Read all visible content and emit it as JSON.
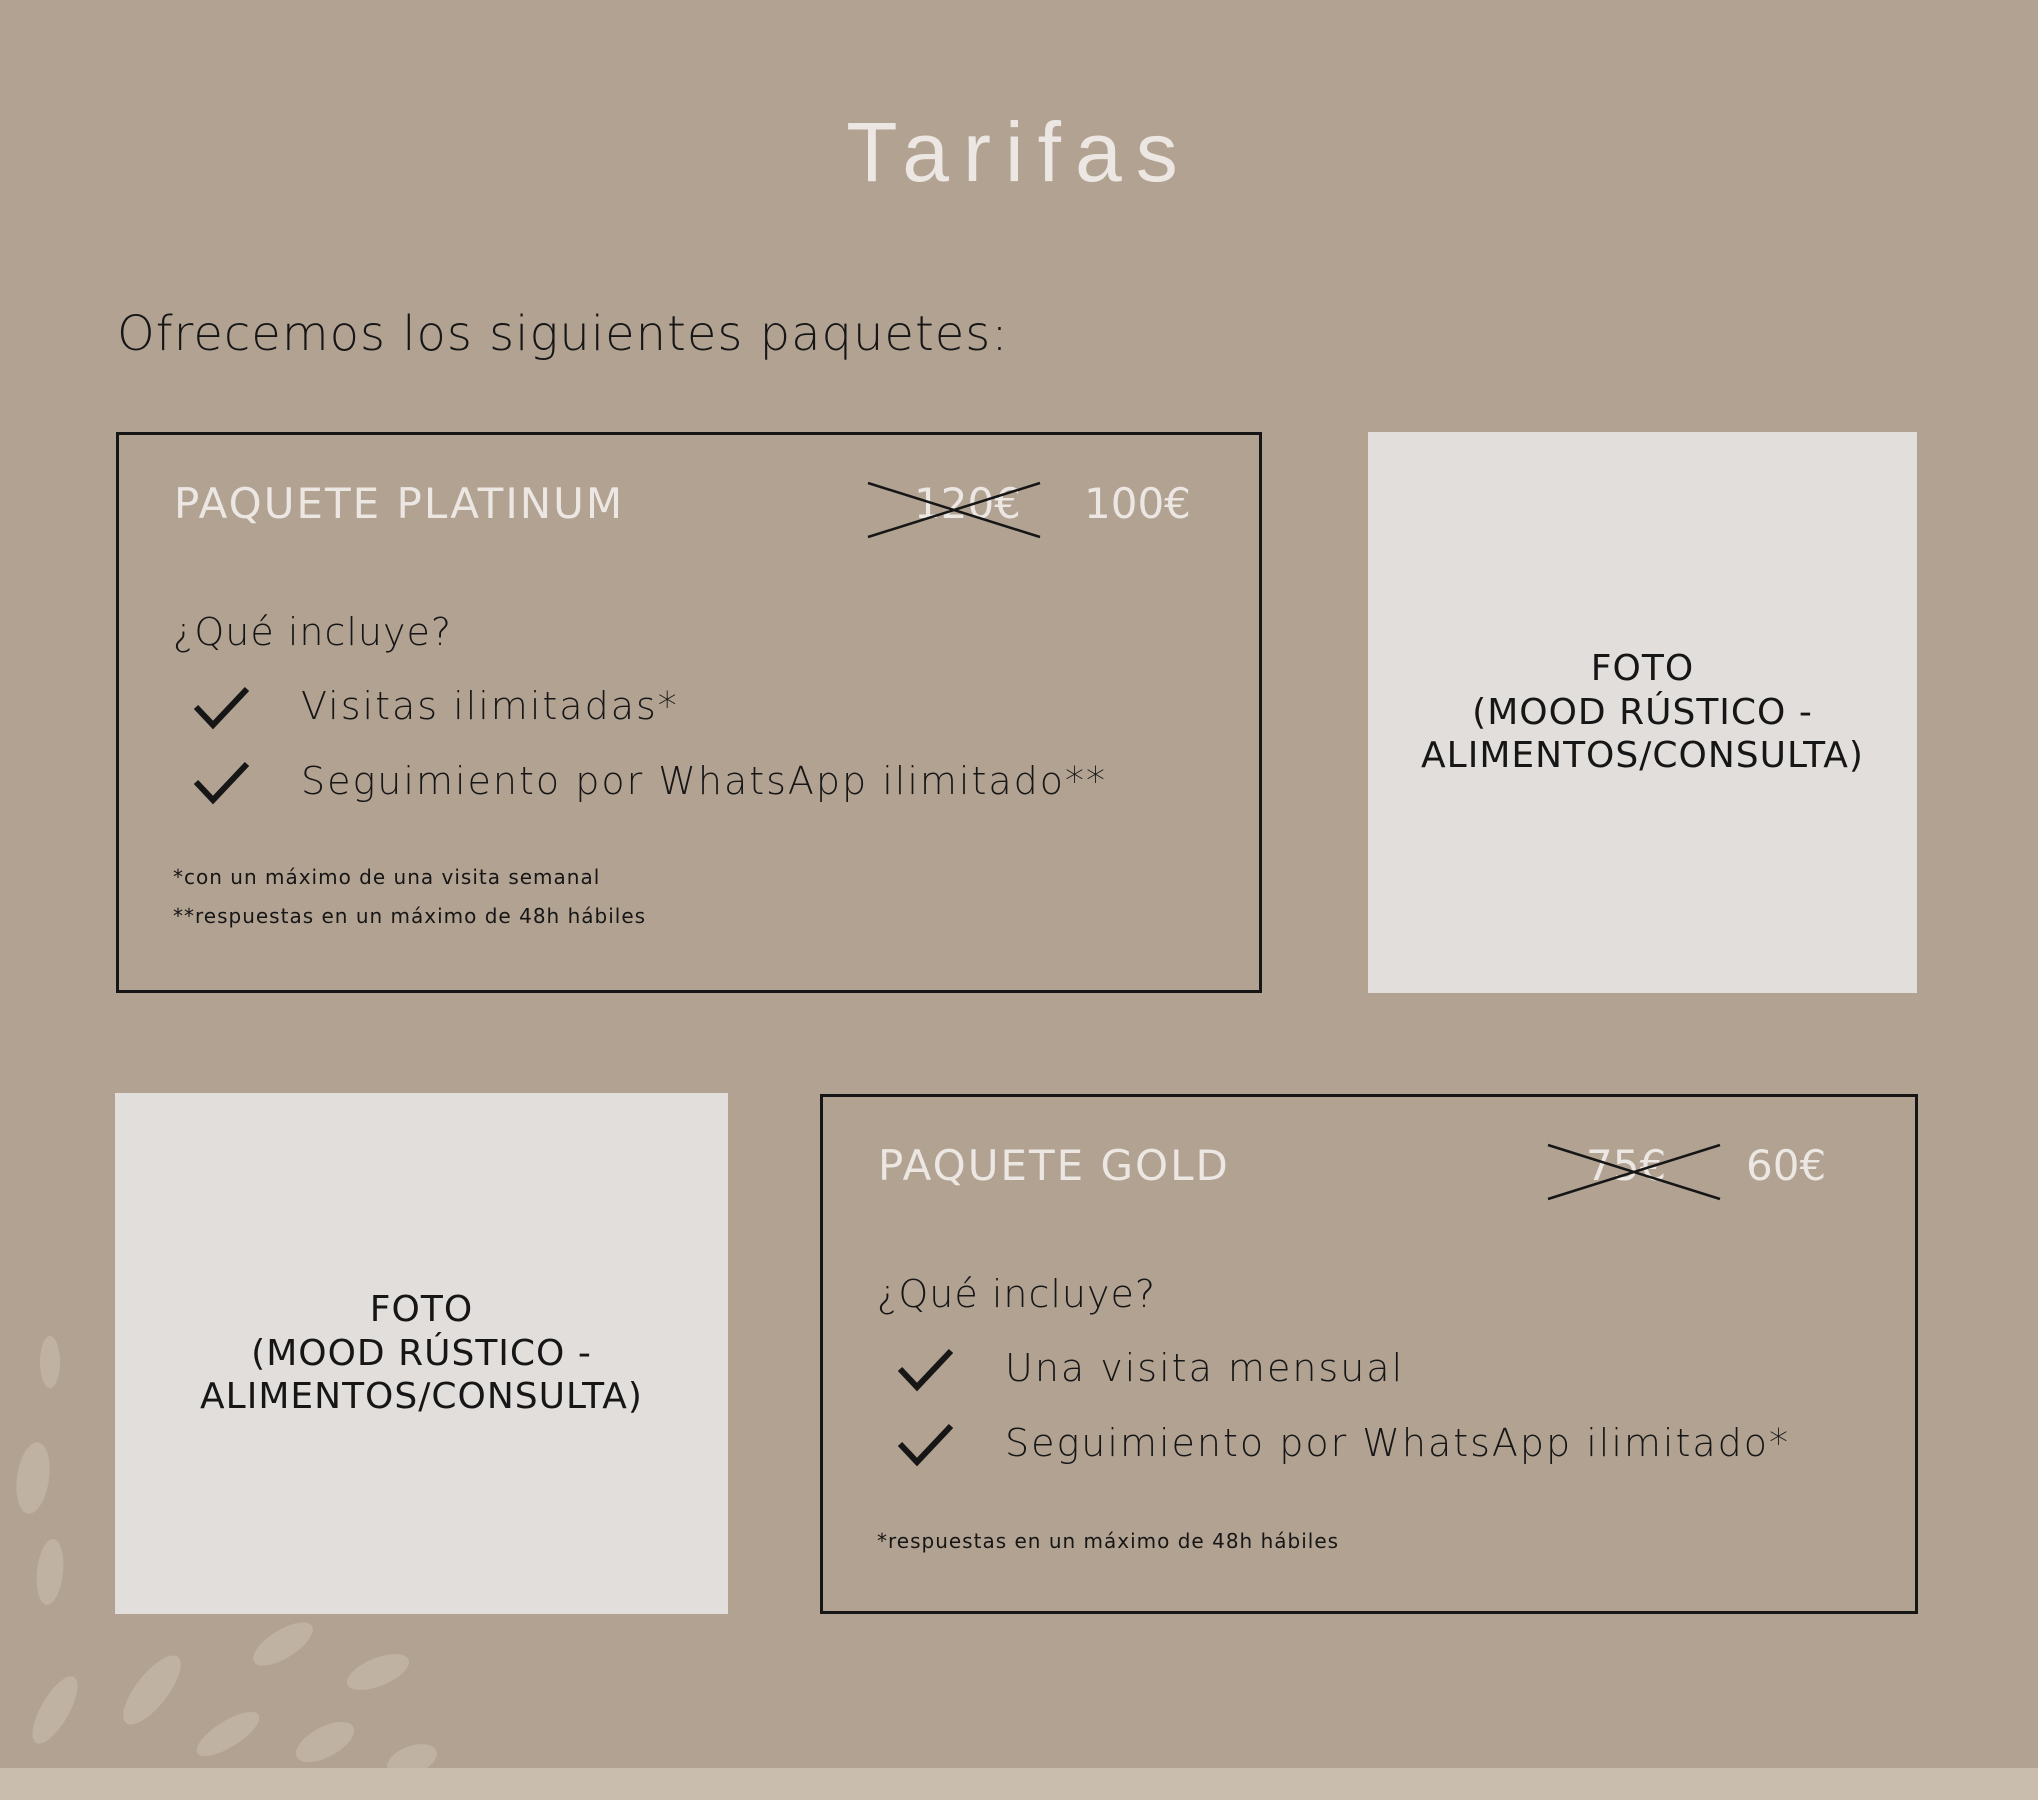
{
  "header": {
    "title": "Tarifas"
  },
  "intro": "Ofrecemos los siguientes paquetes:",
  "packages": [
    {
      "name": "PAQUETE PLATINUM",
      "old_price": "120€",
      "price": "100€",
      "includes_title": "¿Qué incluye?",
      "features": [
        "Visitas ilimitadas*",
        "Seguimiento por WhatsApp ilimitado**"
      ],
      "notes": [
        "*con un máximo de una visita semanal",
        "**respuestas en un máximo de 48h hábiles"
      ]
    },
    {
      "name": "PAQUETE GOLD",
      "old_price": "75€",
      "price": "60€",
      "includes_title": "¿Qué incluye?",
      "features": [
        "Una visita mensual",
        "Seguimiento por WhatsApp ilimitado*"
      ],
      "notes": [
        "*respuestas en un máximo de 48h hábiles"
      ]
    }
  ],
  "photos": [
    {
      "label": "FOTO\n(MOOD RÚSTICO -\nALIMENTOS/CONSULTA)"
    },
    {
      "label": "FOTO\n(MOOD RÚSTICO -\nALIMENTOS/CONSULTA)"
    }
  ],
  "colors": {
    "background": "#b2a292",
    "light_text": "#ece7e3",
    "dark_text": "#161616",
    "photo_placeholder": "#e1dedc",
    "bottom_band": "#c9bdad"
  },
  "icons": [
    "check-icon",
    "strikethrough-cross-icon",
    "decorative-brush-strokes"
  ]
}
